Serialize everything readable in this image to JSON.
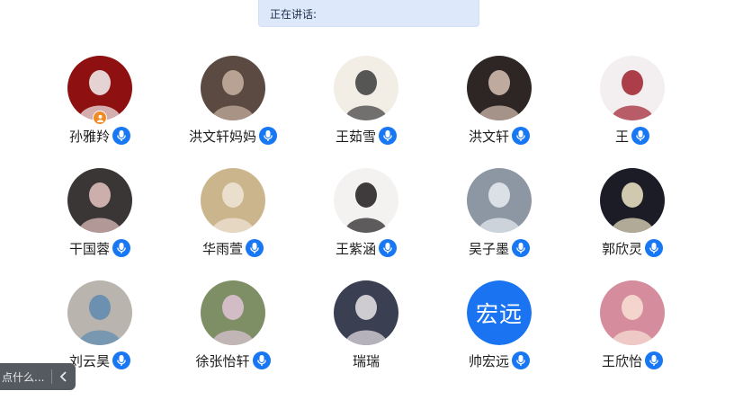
{
  "banner": {
    "label": "正在讲话:"
  },
  "members": [
    {
      "name": "孙雅羚",
      "host": true,
      "mic": true,
      "avatar_icon": "wedding-couple-photo",
      "bg": "#8e1010",
      "fg": "#f4f4f4"
    },
    {
      "name": "洪文轩妈妈",
      "host": false,
      "mic": true,
      "avatar_icon": "woman-with-cat-photo",
      "bg": "#5b4a42",
      "fg": "#c9b2a1"
    },
    {
      "name": "王茹雪",
      "host": false,
      "mic": true,
      "avatar_icon": "cartoon-girl-with-hat",
      "bg": "#f2eee6",
      "fg": "#3b3b3b"
    },
    {
      "name": "洪文轩",
      "host": false,
      "mic": true,
      "avatar_icon": "portrait-photo",
      "bg": "#2e2624",
      "fg": "#d8c2b6"
    },
    {
      "name": "王",
      "host": false,
      "mic": true,
      "avatar_icon": "anime-girl-red-dress",
      "bg": "#f3eff0",
      "fg": "#9e1f2c"
    },
    {
      "name": "干国蓉",
      "host": false,
      "mic": true,
      "avatar_icon": "child-at-piano-photo",
      "bg": "#3b3636",
      "fg": "#e6c3c0"
    },
    {
      "name": "华雨萱",
      "host": false,
      "mic": true,
      "avatar_icon": "anime-girl-curly-hair",
      "bg": "#cbb58c",
      "fg": "#f0e6d8"
    },
    {
      "name": "王紫涵",
      "host": false,
      "mic": true,
      "avatar_icon": "dark-hair-girl-illustration",
      "bg": "#f4f1f1",
      "fg": "#1e1b1d"
    },
    {
      "name": "吴子墨",
      "host": false,
      "mic": true,
      "avatar_icon": "mecha-boy-illustration",
      "bg": "#8d97a4",
      "fg": "#e7ecf2"
    },
    {
      "name": "郭欣灵",
      "host": false,
      "mic": true,
      "avatar_icon": "night-sky-glow",
      "bg": "#1b1c26",
      "fg": "#f1e7c8"
    },
    {
      "name": "刘云昊",
      "host": false,
      "mic": true,
      "avatar_icon": "family-photo",
      "bg": "#b9b4ad",
      "fg": "#5d8ab0"
    },
    {
      "name": "徐张怡轩",
      "host": false,
      "mic": true,
      "avatar_icon": "flower-field-photo",
      "bg": "#7e8f66",
      "fg": "#e0c5d8"
    },
    {
      "name": "瑞瑞",
      "host": false,
      "mic": false,
      "avatar_icon": "masked-boy-illustration",
      "bg": "#3a3f52",
      "fg": "#e9e4e8"
    },
    {
      "name": "帅宏远",
      "host": false,
      "mic": true,
      "avatar_icon": "",
      "avatar_text": "宏远",
      "bg": "#1a73f0",
      "fg": "#ffffff"
    },
    {
      "name": "王欣怡",
      "host": false,
      "mic": true,
      "avatar_icon": "fox-girl-illustration",
      "bg": "#d58d9d",
      "fg": "#f8e2d6"
    }
  ],
  "bottom_bar": {
    "hint": "点什么...",
    "collapse_icon": "chevron-left-icon"
  },
  "colors": {
    "accent": "#1877f2",
    "host_badge": "#f08a24",
    "banner_bg": "#dde9fb"
  }
}
